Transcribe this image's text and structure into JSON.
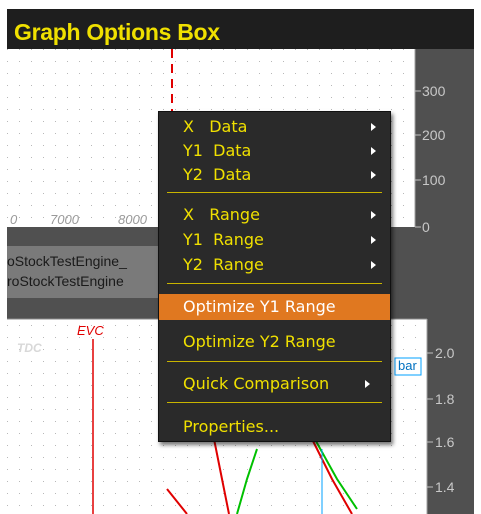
{
  "title": "Graph Options Box",
  "upper_plot": {
    "y_ticks": [
      "300",
      "200",
      "100",
      "0"
    ],
    "x_ticks": [
      "0",
      "7000",
      "8000"
    ]
  },
  "file_labels": [
    "oStockTestEngine_",
    "roStockTestEngine"
  ],
  "lower_plot": {
    "marker_tdc": "TDC",
    "marker_evc": "EVC",
    "legend_tag": "bar",
    "y_ticks": [
      "2.0",
      "1.8",
      "1.6",
      "1.4"
    ]
  },
  "context_menu": {
    "items": [
      {
        "label": "X   Data",
        "submenu": true
      },
      {
        "label": "Y1  Data",
        "submenu": true
      },
      {
        "label": "Y2  Data",
        "submenu": true
      },
      {
        "label": "X   Range",
        "submenu": true
      },
      {
        "label": "Y1  Range",
        "submenu": true
      },
      {
        "label": "Y2  Range",
        "submenu": true
      },
      {
        "label": "Optimize Y1 Range",
        "submenu": false,
        "highlighted": true
      },
      {
        "label": "Optimize Y2 Range",
        "submenu": false
      },
      {
        "label": "Quick Comparison",
        "submenu": true
      },
      {
        "label": "Properties...",
        "submenu": false
      }
    ]
  },
  "colors": {
    "title_text": "#f0e000",
    "menu_text": "#f0e000",
    "highlight": "#e07820",
    "trace_red": "#e00000",
    "trace_green": "#00c000",
    "trace_blue": "#00a0ff"
  }
}
